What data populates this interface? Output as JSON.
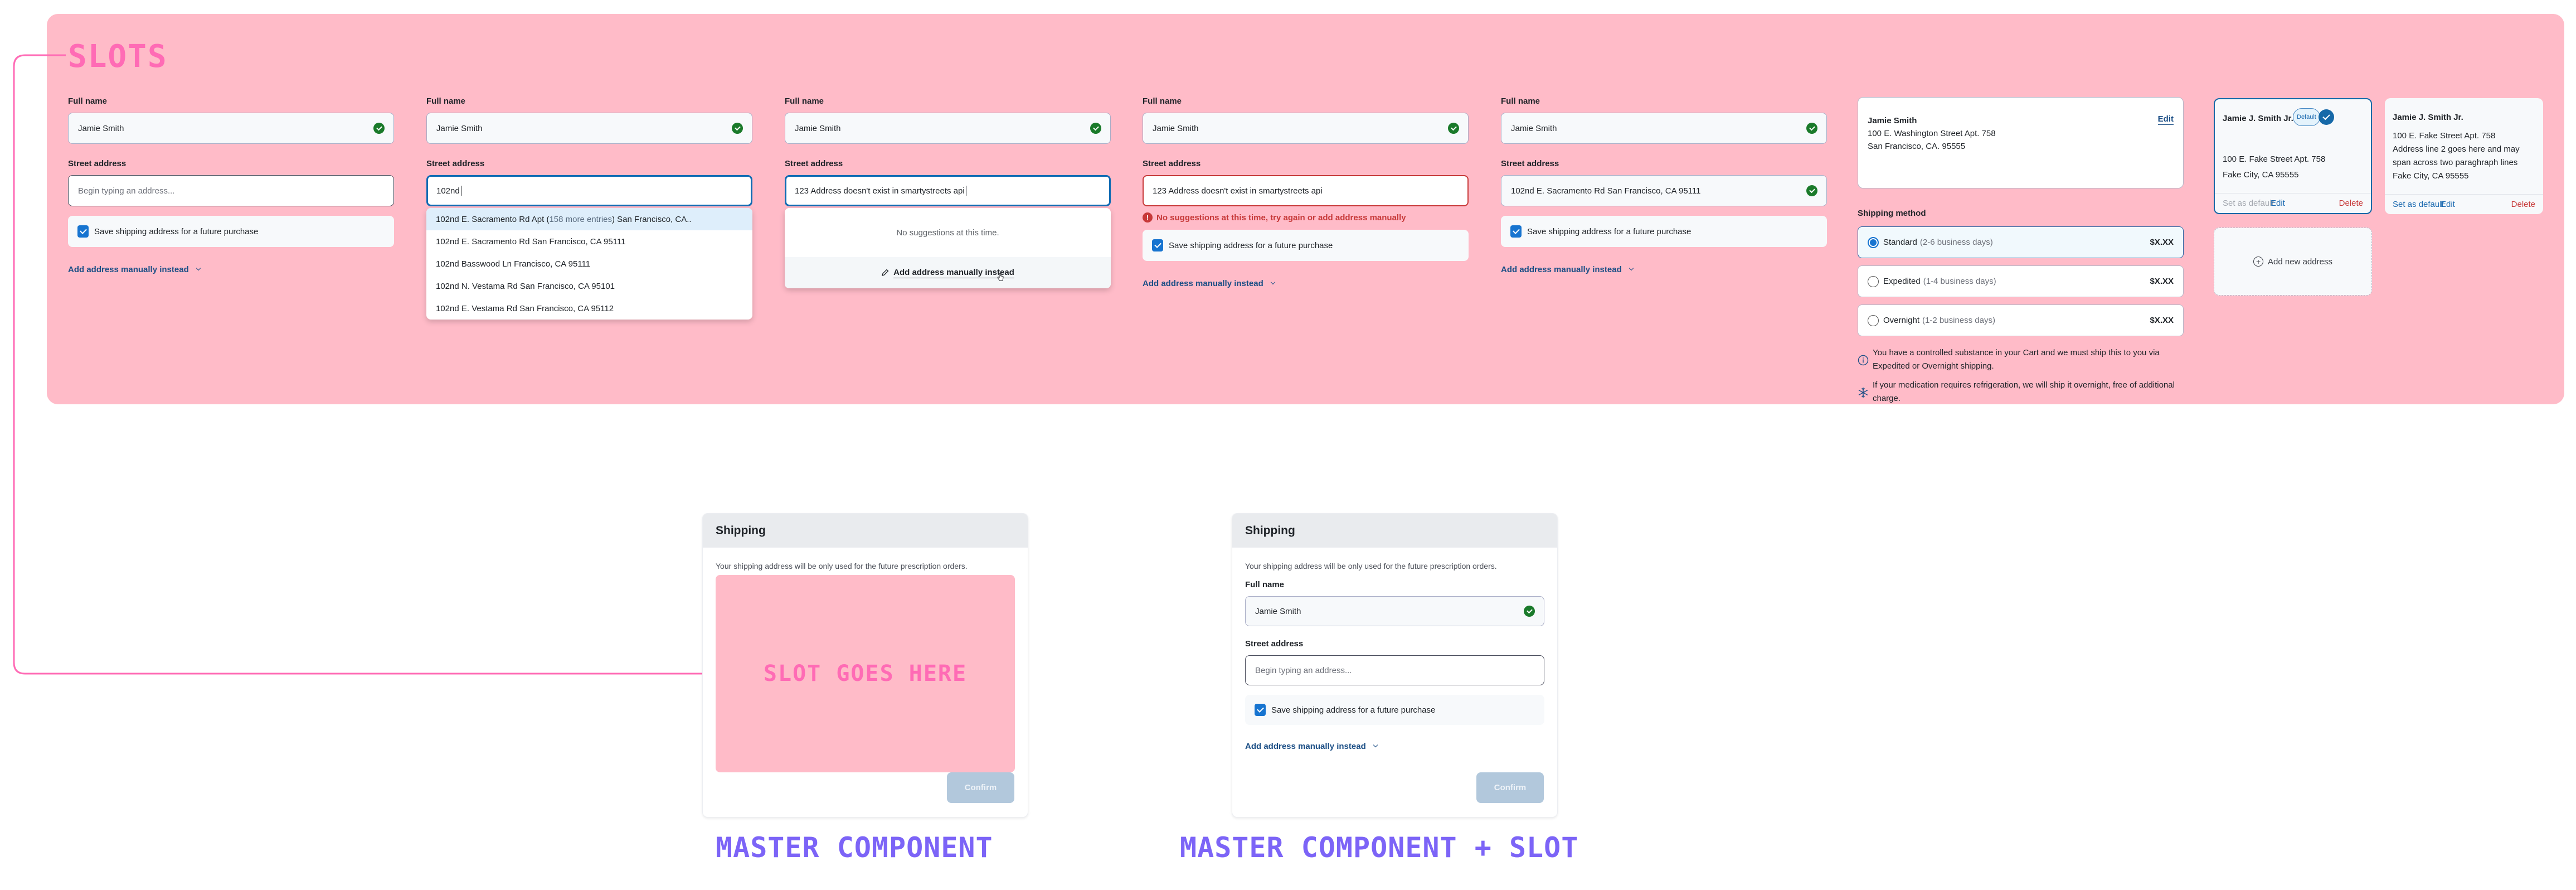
{
  "slots_title": "SLOTS",
  "colors": {
    "slot_pink": "#ffbbc8",
    "slot_accent": "#ff6bb5",
    "caption_purple": "#7c64f7",
    "link_blue": "#1c4f86",
    "focus_blue": "#0f6bb3",
    "error_red": "#c73939",
    "success_green": "#1a7a2a"
  },
  "common": {
    "full_name_label": "Full name",
    "street_label": "Street address",
    "name_value": "Jamie Smith",
    "street_placeholder": "Begin typing an address...",
    "save_label": "Save shipping address for a future purchase",
    "manual_link": "Add address manually instead"
  },
  "states": {
    "empty": {
      "street_value": ""
    },
    "typing": {
      "street_value": "102nd",
      "suggestions": [
        {
          "prefix": "102nd E. Sacramento Rd Apt (",
          "muted": "158 more entries",
          "suffix": ") San Francisco, CA.."
        },
        {
          "prefix": "102nd E. Sacramento Rd San Francisco, CA 95111",
          "muted": "",
          "suffix": ""
        },
        {
          "prefix": "102nd Basswood Ln Francisco, CA 95111",
          "muted": "",
          "suffix": ""
        },
        {
          "prefix": "102nd N. Vestama Rd San Francisco, CA 95101",
          "muted": "",
          "suffix": ""
        },
        {
          "prefix": "102nd E. Vestama Rd San Francisco, CA 95112",
          "muted": "",
          "suffix": ""
        }
      ]
    },
    "no_results": {
      "street_value": "123 Address doesn't exist in smartystreets api",
      "empty_message": "No suggestions at this time.",
      "footer_link": "Add address manually instead"
    },
    "error": {
      "street_value": "123 Address doesn't exist in smartystreets api",
      "error_message": "No suggestions at this time, try again or add address manually"
    },
    "valid": {
      "street_value": "102nd E. Sacramento Rd San Francisco, CA 95111"
    }
  },
  "shipping": {
    "address": {
      "name": "Jamie Smith",
      "line1": "100 E. Washington Street Apt. 758",
      "line2": "San Francisco, CA. 95555",
      "edit_label": "Edit"
    },
    "method_label": "Shipping method",
    "options": [
      {
        "name": "Standard",
        "detail": "(2-6 business days)",
        "price": "$X.XX",
        "selected": true
      },
      {
        "name": "Expedited",
        "detail": "(1-4 business days)",
        "price": "$X.XX",
        "selected": false
      },
      {
        "name": "Overnight",
        "detail": "(1-2 business days)",
        "price": "$X.XX",
        "selected": false
      }
    ],
    "notes": [
      {
        "icon": "info-icon",
        "text": "You have a controlled substance in your Cart and we must ship this to you via Expedited or Overnight shipping."
      },
      {
        "icon": "snowflake-icon",
        "text": "If your medication requires refrigeration, we will ship it overnight, free of additional charge."
      }
    ]
  },
  "address_cards": [
    {
      "name": "Jamie J. Smith Jr.",
      "badge": "Default",
      "selected": true,
      "lines": [
        "100 E. Fake Street Apt. 758",
        "Fake City, CA 95555"
      ],
      "set_default": "Set as default",
      "edit": "Edit",
      "delete": "Delete"
    },
    {
      "name": "Jamie J. Smith Jr.",
      "badge": "",
      "selected": false,
      "lines": [
        "100 E. Fake Street Apt. 758",
        "Address line 2 goes here and may",
        "span across two paraghraph lines",
        "Fake City, CA 95555"
      ],
      "set_default": "Set as default",
      "edit": "Edit",
      "delete": "Delete"
    }
  ],
  "add_new_address": "Add new address",
  "master": {
    "header": "Shipping",
    "description": "Your shipping address will be only used for the future prescription orders.",
    "slot_placeholder": "SLOT GOES HERE",
    "confirm": "Confirm",
    "caption": "MASTER COMPONENT"
  },
  "master_slot": {
    "header": "Shipping",
    "description": "Your shipping address will be only used for the future prescription orders.",
    "confirm": "Confirm",
    "caption": "MASTER COMPONENT + SLOT"
  }
}
